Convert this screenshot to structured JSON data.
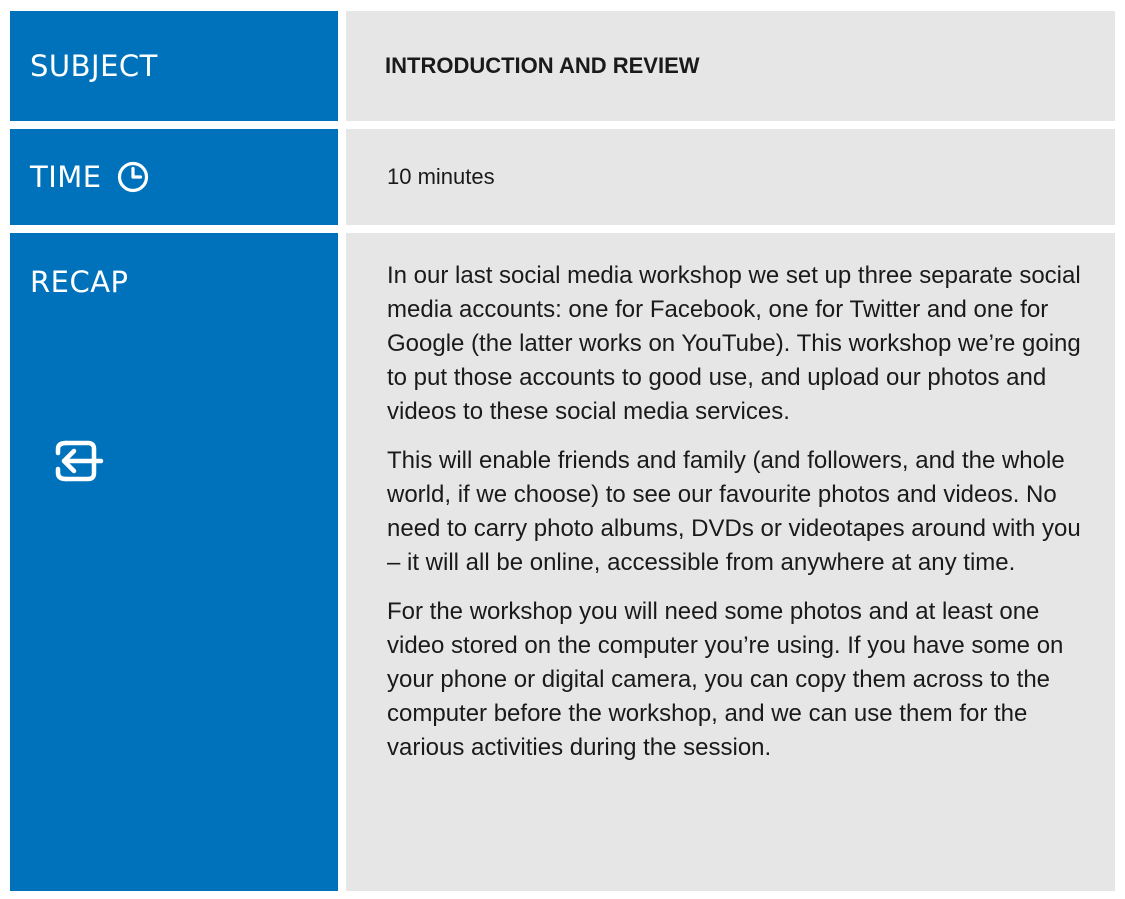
{
  "colors": {
    "label_bg": "#0072bc",
    "content_bg": "#e6e6e6",
    "label_text": "#ffffff"
  },
  "subject": {
    "label": "SUBJECT",
    "value": "INTRODUCTION AND REVIEW"
  },
  "time": {
    "label": "TIME",
    "icon": "clock-icon",
    "value": "10 minutes"
  },
  "recap": {
    "label": "RECAP",
    "icon": "login-arrow-icon",
    "paragraphs": [
      "In our last social media workshop we set up three separate social media accounts: one for Facebook, one for Twitter and one for Google (the latter works on YouTube). This workshop we’re going to put those accounts to good use, and upload our photos and videos to these social media services.",
      "This will enable friends and family (and followers, and the whole world, if we choose) to see our favourite photos and videos. No need to carry photo albums, DVDs or videotapes around with you – it will all be online, accessible from anywhere at any time.",
      "For the workshop you will need some photos and at least one video stored on the computer you’re using. If you have some on your phone or digital camera, you can copy them across to the computer before the workshop, and we can use them for the various activities during the session."
    ]
  }
}
